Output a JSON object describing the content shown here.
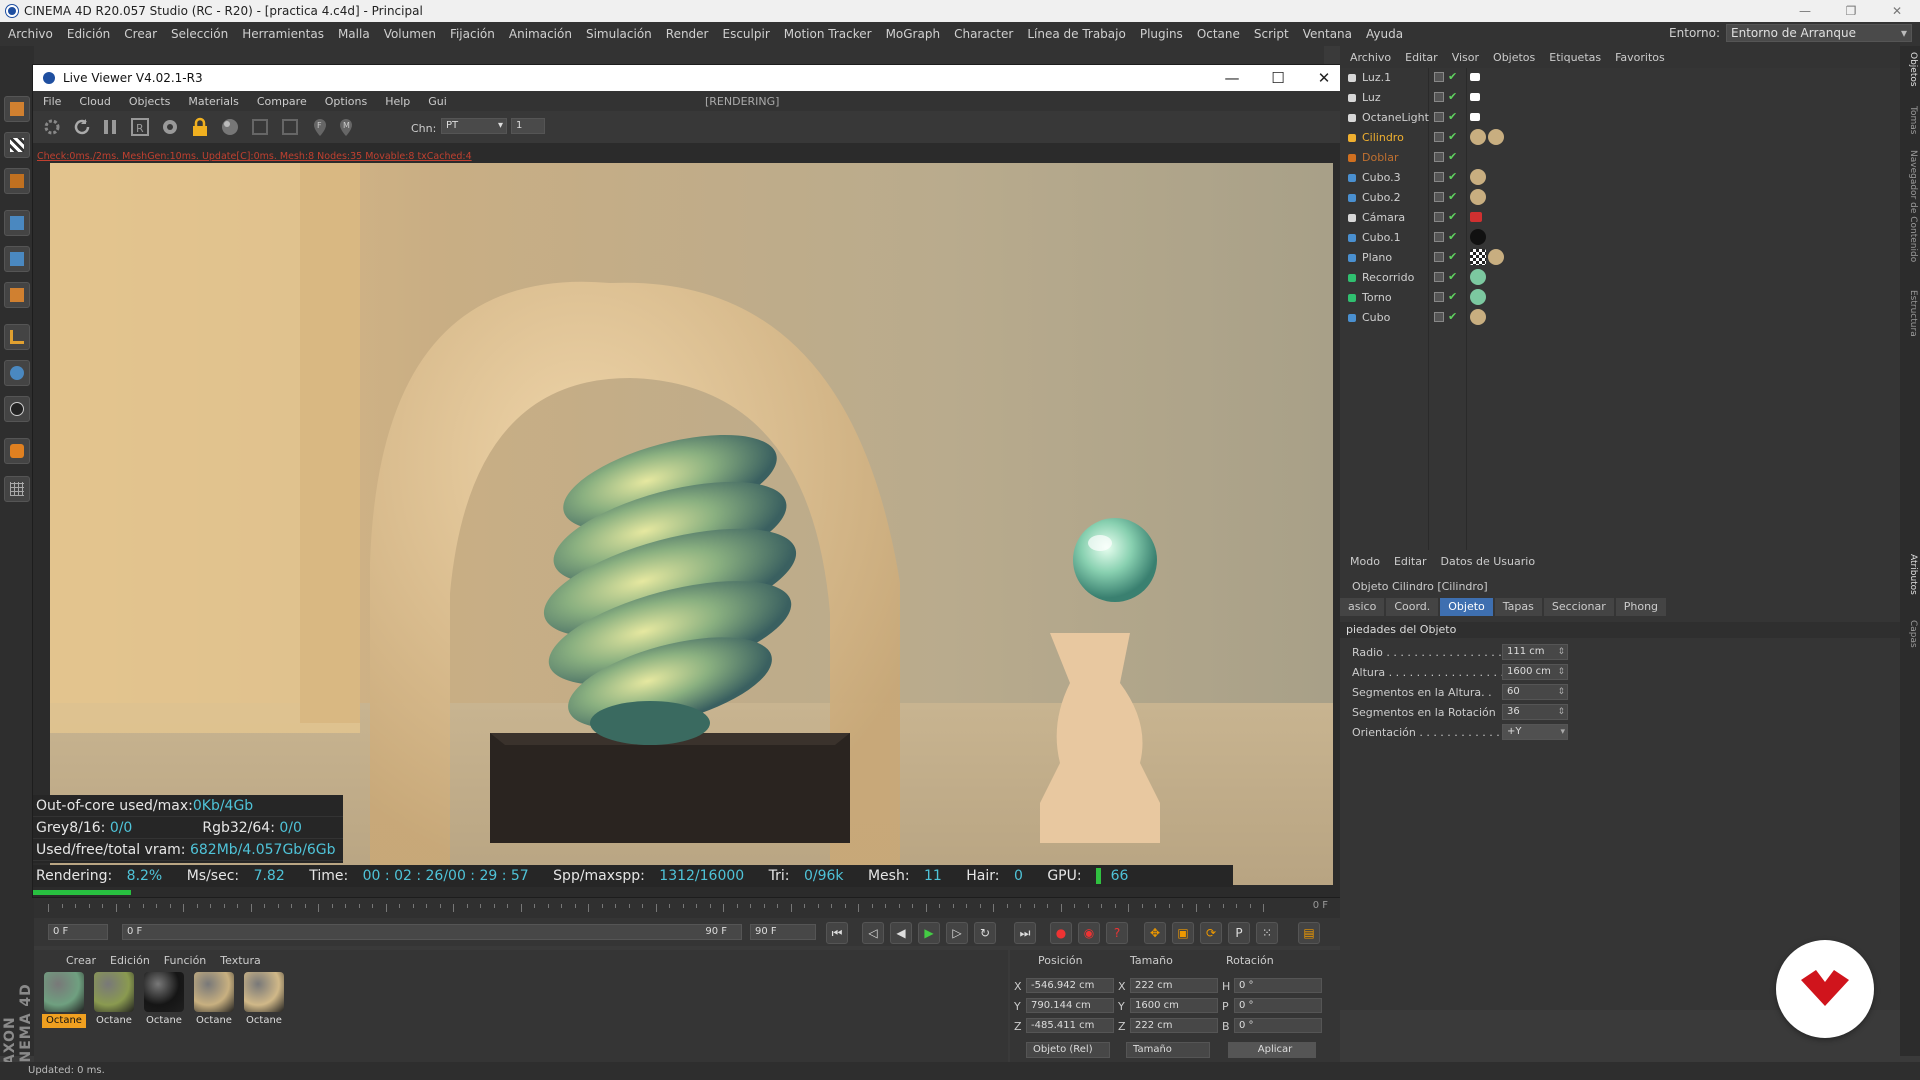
{
  "app": {
    "title": "CINEMA 4D R20.057 Studio (RC - R20) - [practica 4.c4d] - Principal",
    "window_controls": [
      "—",
      "❐",
      "✕"
    ]
  },
  "main_menu": [
    "Archivo",
    "Edición",
    "Crear",
    "Selección",
    "Herramientas",
    "Malla",
    "Volumen",
    "Fijación",
    "Animación",
    "Simulación",
    "Render",
    "Esculpir",
    "Motion Tracker",
    "MoGraph",
    "Character",
    "Línea de Trabajo",
    "Plugins",
    "Octane",
    "Script",
    "Ventana",
    "Ayuda"
  ],
  "environment": {
    "label": "Entorno:",
    "value": "Entorno de Arranque"
  },
  "live_viewer": {
    "title": "Live Viewer V4.02.1-R3",
    "menu": [
      "File",
      "Cloud",
      "Objects",
      "Materials",
      "Compare",
      "Options",
      "Help",
      "Gui"
    ],
    "status": "[RENDERING]",
    "chn_label": "Chn:",
    "chn_value": "PT",
    "chn_num": "1",
    "check_line": "Check:0ms./2ms. MeshGen:10ms. Update[C]:0ms. Mesh:8 Nodes:35 Movable:8 txCached:4",
    "stats": {
      "out_of_core_label": "Out-of-core used/max:",
      "out_of_core_value": "0Kb/4Gb",
      "grey_label": "Grey8/16:",
      "grey_value": "0/0",
      "rgb_label": "Rgb32/64:",
      "rgb_value": "0/0",
      "vram_label": "Used/free/total vram:",
      "vram_value": "682Mb/4.057Gb/6Gb",
      "rendering_label": "Rendering:",
      "rendering_value": "8.2%",
      "mssec_label": "Ms/sec:",
      "mssec_value": "7.82",
      "time_label": "Time:",
      "time_value": "00 : 02 : 26/00 : 29 : 57",
      "spp_label": "Spp/maxspp:",
      "spp_value": "1312/16000",
      "tri_label": "Tri:",
      "tri_value": "0/96k",
      "mesh_label": "Mesh:",
      "mesh_value": "11",
      "hair_label": "Hair:",
      "hair_value": "0",
      "gpu_label": "GPU:",
      "gpu_value": "66"
    },
    "render_progress": 0.082
  },
  "objects_manager": {
    "menu": [
      "Archivo",
      "Editar",
      "Visor",
      "Objetos",
      "Etiquetas",
      "Favoritos"
    ],
    "objects": [
      {
        "name": "Luz.1",
        "color": "#d8d8d8",
        "tags": [
          "light-tag"
        ]
      },
      {
        "name": "Luz",
        "color": "#d8d8d8",
        "tags": [
          "light-tag"
        ]
      },
      {
        "name": "OctaneLight",
        "color": "#d8d8d8",
        "tags": [
          "light-tag"
        ]
      },
      {
        "name": "Cilindro",
        "color": "#f0b030",
        "tags": [
          "material-tag",
          "material-tag"
        ]
      },
      {
        "name": "Doblar",
        "color": "#d07020",
        "tags": []
      },
      {
        "name": "Cubo.3",
        "color": "#4a90d0",
        "tags": [
          "material-tag"
        ]
      },
      {
        "name": "Cubo.2",
        "color": "#4a90d0",
        "tags": [
          "material-tag"
        ]
      },
      {
        "name": "Cámara",
        "color": "#d8d8d8",
        "tags": [
          "camera-tag"
        ]
      },
      {
        "name": "Cubo.1",
        "color": "#4a90d0",
        "tags": [
          "black-material-tag"
        ]
      },
      {
        "name": "Plano",
        "color": "#4a90d0",
        "tags": [
          "checker-tag",
          "material-tag"
        ]
      },
      {
        "name": "Recorrido",
        "color": "#30c070",
        "tags": [
          "glass-material-tag"
        ]
      },
      {
        "name": "Torno",
        "color": "#30c070",
        "tags": [
          "glass-material-tag"
        ]
      },
      {
        "name": "Cubo",
        "color": "#4a90d0",
        "tags": [
          "material-tag"
        ]
      }
    ]
  },
  "attributes": {
    "menu": [
      "Modo",
      "Editar",
      "Datos de Usuario"
    ],
    "title": "Objeto Cilindro [Cilindro]",
    "tabs": [
      "asico",
      "Coord.",
      "Objeto",
      "Tapas",
      "Seccionar",
      "Phong"
    ],
    "active_tab": "Objeto",
    "section": "piedades del Objeto",
    "params": [
      {
        "label": "Radio . . . . . . . . . . . . . . . . . . .",
        "value": "111 cm"
      },
      {
        "label": "Altura . . . . . . . . . . . . . . . . . . .",
        "value": "1600 cm"
      },
      {
        "label": "Segmentos en la Altura. .",
        "value": "60"
      },
      {
        "label": "Segmentos en la Rotación",
        "value": "36"
      },
      {
        "label": "Orientación . . . . . . . . . . . . .",
        "value": "+Y"
      }
    ]
  },
  "right_vertical_tabs": [
    "Objetos",
    "Tomas",
    "Navegador de Contenido",
    "Estructura",
    "Atributos",
    "Capas"
  ],
  "timeline": {
    "current_frame": "0 F",
    "start_frame": "0 F",
    "range_end": "90 F",
    "end_frame": "90 F",
    "right_marker": "0 F"
  },
  "materials": {
    "menu": [
      "Crear",
      "Edición",
      "Función",
      "Textura"
    ],
    "items": [
      {
        "label": "Octane",
        "selected": true,
        "swatch": "#6fa080"
      },
      {
        "label": "Octane",
        "selected": false,
        "swatch": "#8a9a50"
      },
      {
        "label": "Octane",
        "selected": false,
        "swatch": "#151515"
      },
      {
        "label": "Octane",
        "selected": false,
        "swatch": "#c8b080"
      },
      {
        "label": "Octane",
        "selected": false,
        "swatch": "#d0b888"
      }
    ]
  },
  "coordinates": {
    "headers": [
      "Posición",
      "Tamaño",
      "Rotación"
    ],
    "rows": [
      {
        "axis": "X",
        "pos": "-546.942 cm",
        "size_axis": "X",
        "size": "222 cm",
        "rot_axis": "H",
        "rot": "0 °"
      },
      {
        "axis": "Y",
        "pos": "790.144 cm",
        "size_axis": "Y",
        "size": "1600 cm",
        "rot_axis": "P",
        "rot": "0 °"
      },
      {
        "axis": "Z",
        "pos": "-485.411 cm",
        "size_axis": "Z",
        "size": "222 cm",
        "rot_axis": "B",
        "rot": "0 °"
      }
    ],
    "mode_dropdown": "Objeto (Rel)",
    "size_dropdown": "Tamaño",
    "apply_button": "Aplicar"
  },
  "status_bar": "Updated: 0 ms.",
  "maxon_logo": "MAXON CINEMA 4D"
}
